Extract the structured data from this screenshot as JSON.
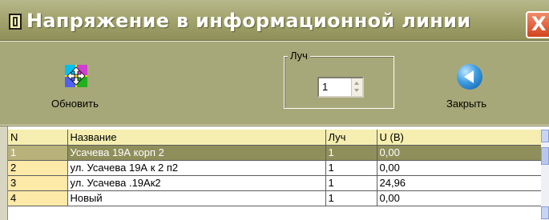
{
  "window": {
    "title": "Напряжение в информационной линии",
    "close_glyph": "X"
  },
  "toolbar": {
    "refresh_label": "Обновить",
    "refresh_icon": "refresh-icon",
    "luch_group_label": "Луч",
    "luch_value": "1",
    "close_label": "Закрыть",
    "close_icon": "back-arrow-icon"
  },
  "grid": {
    "columns": [
      "N",
      "Название",
      "Луч",
      "U (В)"
    ],
    "rows": [
      {
        "n": "1",
        "name": "Усачева 19А корп 2",
        "luch": "1",
        "u": "0,00"
      },
      {
        "n": "2",
        "name": "ул. Усачева 19А к 2 п2",
        "luch": "1",
        "u": "0,00"
      },
      {
        "n": "3",
        "name": "ул. Усачева .19Ак2",
        "luch": "1",
        "u": "24,96"
      },
      {
        "n": "4",
        "name": "Новый",
        "luch": "1",
        "u": "0,00"
      }
    ],
    "selected_row": 0
  },
  "colors": {
    "titlebar": "#a3a46f",
    "toolbar": "#a7a879",
    "selected_row": "#8f8f5c",
    "header_bg": "#f5eeb0",
    "close_button": "#d2461d"
  }
}
